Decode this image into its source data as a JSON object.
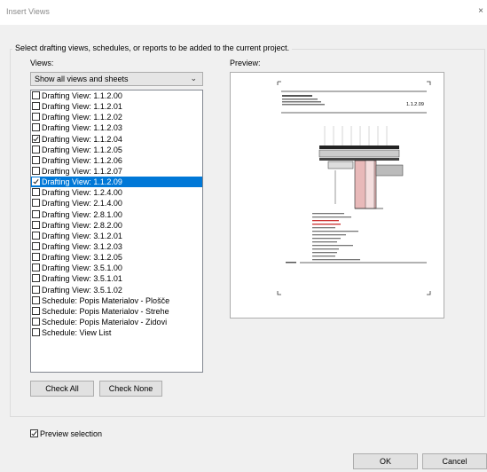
{
  "window": {
    "title": "Insert Views",
    "close_glyph": "×"
  },
  "group": {
    "caption": "Select drafting views, schedules, or reports to be added to the current project."
  },
  "views_label": "Views:",
  "preview_label": "Preview:",
  "filter": {
    "selected": "Show all views and sheets"
  },
  "views": [
    {
      "label": "Drafting View: 1.1.2.00",
      "checked": false,
      "selected": false
    },
    {
      "label": "Drafting View: 1.1.2.01",
      "checked": false,
      "selected": false
    },
    {
      "label": "Drafting View: 1.1.2.02",
      "checked": false,
      "selected": false
    },
    {
      "label": "Drafting View: 1.1.2.03",
      "checked": false,
      "selected": false
    },
    {
      "label": "Drafting View: 1.1.2.04",
      "checked": true,
      "selected": false
    },
    {
      "label": "Drafting View: 1.1.2.05",
      "checked": false,
      "selected": false
    },
    {
      "label": "Drafting View: 1.1.2.06",
      "checked": false,
      "selected": false
    },
    {
      "label": "Drafting View: 1.1.2.07",
      "checked": false,
      "selected": false
    },
    {
      "label": "Drafting View: 1.1.2.09",
      "checked": true,
      "selected": true
    },
    {
      "label": "Drafting View: 1.2.4.00",
      "checked": false,
      "selected": false
    },
    {
      "label": "Drafting View: 2.1.4.00",
      "checked": false,
      "selected": false
    },
    {
      "label": "Drafting View: 2.8.1.00",
      "checked": false,
      "selected": false
    },
    {
      "label": "Drafting View: 2.8.2.00",
      "checked": false,
      "selected": false
    },
    {
      "label": "Drafting View: 3.1.2.01",
      "checked": false,
      "selected": false
    },
    {
      "label": "Drafting View: 3.1.2.03",
      "checked": false,
      "selected": false
    },
    {
      "label": "Drafting View: 3.1.2.05",
      "checked": false,
      "selected": false
    },
    {
      "label": "Drafting View: 3.5.1.00",
      "checked": false,
      "selected": false
    },
    {
      "label": "Drafting View: 3.5.1.01",
      "checked": false,
      "selected": false
    },
    {
      "label": "Drafting View: 3.5.1.02",
      "checked": false,
      "selected": false
    },
    {
      "label": "Schedule: Popis Materialov - Plošče",
      "checked": false,
      "selected": false
    },
    {
      "label": "Schedule: Popis Materialov - Strehe",
      "checked": false,
      "selected": false
    },
    {
      "label": "Schedule: Popis Materialov - Zidovi",
      "checked": false,
      "selected": false
    },
    {
      "label": "Schedule: View List",
      "checked": false,
      "selected": false
    }
  ],
  "buttons": {
    "check_all": "Check All",
    "check_none": "Check None",
    "ok": "OK",
    "cancel": "Cancel"
  },
  "preview_selection": {
    "label": "Preview selection",
    "checked": true
  },
  "preview_sheet": {
    "number": "1.1.2.09"
  },
  "colors": {
    "selection": "#0078d7",
    "background": "#f0f0f0"
  }
}
